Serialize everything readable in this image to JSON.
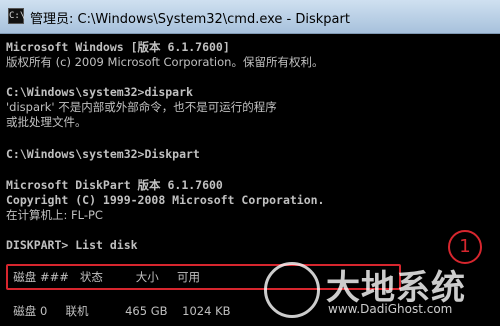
{
  "window": {
    "title": "管理员: C:\\Windows\\System32\\cmd.exe - Diskpart",
    "icon": "cmd-icon"
  },
  "console": {
    "lines": [
      "Microsoft Windows [版本 6.1.7600]",
      "版权所有 (c) 2009 Microsoft Corporation。保留所有权利。",
      "",
      "C:\\Windows\\system32>dispark",
      "'dispark' 不是内部或外部命令，也不是可运行的程序",
      "或批处理文件。",
      "",
      "C:\\Windows\\system32>Diskpart",
      "",
      "Microsoft DiskPart 版本 6.1.7600",
      "Copyright (C) 1999-2008 Microsoft Corporation.",
      "在计算机上: FL-PC",
      "",
      "DISKPART> List disk"
    ],
    "table_header": "  磁盘 ###   状态         大小     可用",
    "table_row": "  磁盘 0     联机          465 GB    1024 KB"
  },
  "annotation": {
    "marker": "1",
    "color": "#d7262e"
  },
  "watermark": {
    "brand": "大地系统",
    "url": "www.DadiGhost.com"
  }
}
